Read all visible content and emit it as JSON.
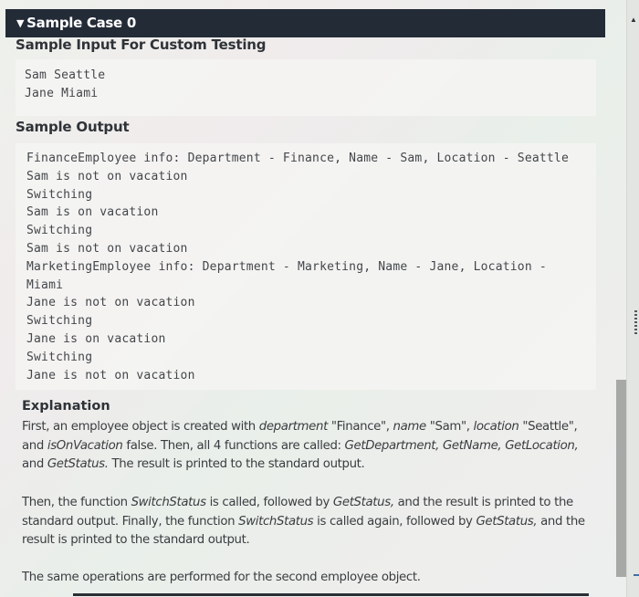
{
  "header": {
    "toggle_icon": "triangle-down-icon",
    "toggle_glyph": "▼",
    "title": "Sample Case 0"
  },
  "sample_input": {
    "title": "Sample Input For Custom Testing",
    "lines": [
      "Sam Seattle",
      "Jane Miami"
    ]
  },
  "sample_output": {
    "title": "Sample Output",
    "lines": [
      "FinanceEmployee info: Department - Finance, Name - Sam, Location - Seattle",
      "Sam is not on vacation",
      "Switching",
      "Sam is on vacation",
      "Switching",
      "Sam is not on vacation",
      "MarketingEmployee info: Department - Marketing, Name - Jane, Location -",
      "Miami",
      "Jane is not on vacation",
      "Switching",
      "Jane is on vacation",
      "Switching",
      "Jane is not on vacation"
    ]
  },
  "explanation": {
    "title": "Explanation",
    "p1": {
      "t1": "First, an employee object is created with ",
      "e1": "department",
      "t2": " \"Finance\", ",
      "e2": "name",
      "t3": " \"Sam\", ",
      "e3": "location",
      "t4": " \"Seattle\", and ",
      "e4": "isOnVacation",
      "t5": " false. Then, all 4 functions are called: ",
      "e5": "GetDepartment,",
      "t6": " ",
      "e6": "GetName,",
      "t7": " ",
      "e7": "GetLocation,",
      "t8": " and ",
      "e8": "GetStatus.",
      "t9": " The result is printed to the standard output."
    },
    "p2": {
      "t1": "Then, the function ",
      "e1": "SwitchStatus",
      "t2": " is called, followed by ",
      "e2": "GetStatus,",
      "t3": " and the result is printed to the standard output. Finally, the function ",
      "e3": "SwitchStatus",
      "t4": " is called again, followed by ",
      "e4": "GetStatus,",
      "t5": " and the result is printed to the standard output."
    },
    "p3": "The same operations are performed for the second employee object."
  },
  "scrollbar": {
    "up_icon": "scroll-up-arrow-icon",
    "up_glyph": "▲",
    "position_fraction": 0.64
  }
}
